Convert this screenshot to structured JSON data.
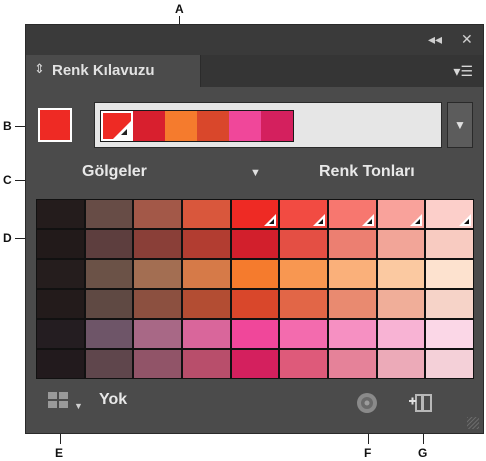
{
  "callouts": [
    "A",
    "B",
    "C",
    "D",
    "E",
    "F",
    "G"
  ],
  "panel": {
    "title": "Renk Kılavuzu",
    "tab_icon": "updown-arrows-icon",
    "collapse_icon": "double-arrow-left-icon",
    "close_icon": "close-icon",
    "menu_icon": "panel-menu-icon"
  },
  "base_color": "#ee2a24",
  "harmony_bar": [
    "#ee2a24",
    "#d81f2e",
    "#f57b2d",
    "#d9472b",
    "#f0479a",
    "#d4205e"
  ],
  "labels": {
    "shades": "Gölgeler",
    "tints": "Renk Tonları",
    "variation": "Yok"
  },
  "grid": [
    [
      "#241c1c",
      "#674c46",
      "#a35848",
      "#d9573c",
      "#ee2a24",
      "#f24b42",
      "#f7776f",
      "#f9a29b",
      "#fccfca"
    ],
    [
      "#221a1a",
      "#5d3e3e",
      "#8a3f38",
      "#b23d31",
      "#d21f2c",
      "#e44f44",
      "#ec7f71",
      "#f2a598",
      "#f8cbc1"
    ],
    [
      "#251d1d",
      "#6b5247",
      "#a36e52",
      "#d67a48",
      "#f57b2d",
      "#f89751",
      "#fab07a",
      "#fbc9a1",
      "#fde2cf"
    ],
    [
      "#231b1b",
      "#5f4943",
      "#8c5040",
      "#b34d33",
      "#d9472b",
      "#e26647",
      "#e98a70",
      "#f0ae99",
      "#f6d3c8"
    ],
    [
      "#241d21",
      "#6e5568",
      "#a86886",
      "#d9669b",
      "#f0479a",
      "#f36bae",
      "#f690c2",
      "#f8b3d4",
      "#fbd7e7"
    ],
    [
      "#221a1d",
      "#5f464c",
      "#915468",
      "#b84e6b",
      "#d4205e",
      "#de5a7a",
      "#e58299",
      "#ecaab8",
      "#f4d0d8"
    ]
  ],
  "grid_markers": [
    4,
    5,
    6,
    7,
    8
  ]
}
